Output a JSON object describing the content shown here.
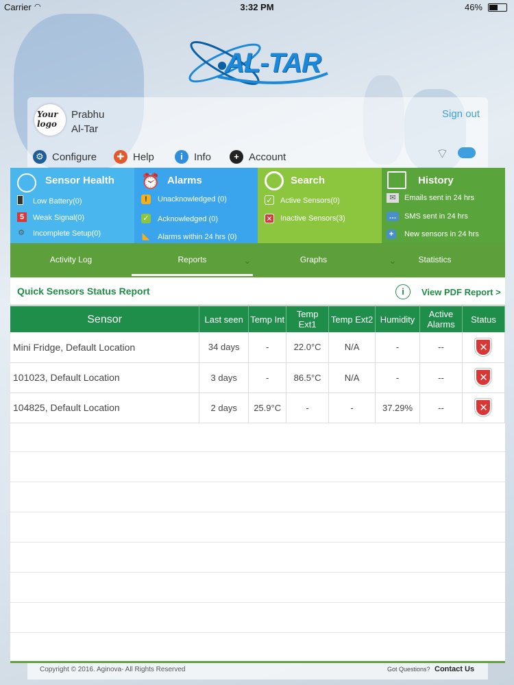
{
  "status_bar": {
    "carrier": "Carrier",
    "time": "3:32 PM",
    "battery": "46%"
  },
  "brand": {
    "logo_text": "AL-TAR"
  },
  "user": {
    "logo_line1": "Your",
    "logo_line2": "logo",
    "first_name": "Prabhu",
    "last_name": "Al-Tar",
    "signout_label": "Sign out"
  },
  "menu": {
    "configure": "Configure",
    "help": "Help",
    "info": "Info",
    "account": "Account"
  },
  "tiles": {
    "sensor_health": {
      "title": "Sensor Health",
      "items": [
        "Low Battery(0)",
        "Weak Signal(0)",
        "Incomplete Setup(0)"
      ]
    },
    "alarms": {
      "title": "Alarms",
      "items": [
        "Unacknowledged (0)",
        "Acknowledged (0)",
        "Alarms within 24 hrs (0)"
      ]
    },
    "search": {
      "title": "Search",
      "items": [
        "Active Sensors(0)",
        "Inactive Sensors(3)"
      ]
    },
    "history": {
      "title": "History",
      "items": [
        "Emails sent in 24 hrs",
        "SMS sent in 24 hrs",
        "New sensors in 24 hrs"
      ]
    }
  },
  "tabs": [
    "Activity Log",
    "Reports",
    "Graphs",
    "Statistics"
  ],
  "report": {
    "title": "Quick Sensors Status Report",
    "pdf_label": "View PDF Report >",
    "columns": [
      "Sensor",
      "Last seen",
      "Temp Int",
      "Temp Ext1",
      "Temp Ext2",
      "Humidity",
      "Active Alarms",
      "Status"
    ],
    "rows": [
      {
        "sensor": "Mini Fridge, Default Location",
        "last_seen": "34 days",
        "temp_int": "-",
        "temp_ext1": "22.0°C",
        "temp_ext2": "N/A",
        "humidity": "-",
        "alarms": "--",
        "status": "inactive"
      },
      {
        "sensor": "101023, Default Location",
        "last_seen": "3 days",
        "temp_int": "-",
        "temp_ext1": "86.5°C",
        "temp_ext2": "N/A",
        "humidity": "-",
        "alarms": "--",
        "status": "inactive"
      },
      {
        "sensor": "104825, Default Location",
        "last_seen": "2 days",
        "temp_int": "25.9°C",
        "temp_ext1": "-",
        "temp_ext2": "-",
        "humidity": "37.29%",
        "alarms": "--",
        "status": "inactive"
      }
    ]
  },
  "footer": {
    "copyright": "Copyright © 2016. Aginova- All Rights Reserved",
    "questions": "Got Questions?",
    "contact": "Contact Us"
  },
  "colors": {
    "accent_green": "#1e8e4a",
    "tab_green": "#5d9f3b",
    "sky_blue": "#49b7ee",
    "alarm_blue": "#3aa4ec",
    "lime": "#8cc63f",
    "status_red": "#d93636"
  }
}
